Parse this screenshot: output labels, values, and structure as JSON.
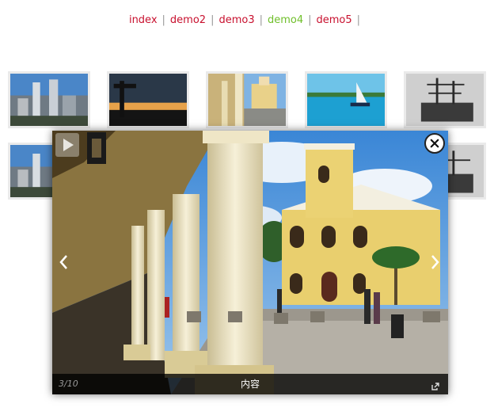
{
  "nav": {
    "items": [
      {
        "label": "index"
      },
      {
        "label": "demo2"
      },
      {
        "label": "demo3"
      },
      {
        "label": "demo4"
      },
      {
        "label": "demo5"
      }
    ],
    "separator": "|"
  },
  "lightbox": {
    "counter": "3/10",
    "caption": "内容",
    "close_icon": "close-icon",
    "play_icon": "play-icon",
    "prev_icon": "chevron-left-icon",
    "next_icon": "chevron-right-icon",
    "open_icon": "external-link-icon"
  },
  "colors": {
    "link": "#c8102e",
    "active_link": "#6fbf2a"
  }
}
